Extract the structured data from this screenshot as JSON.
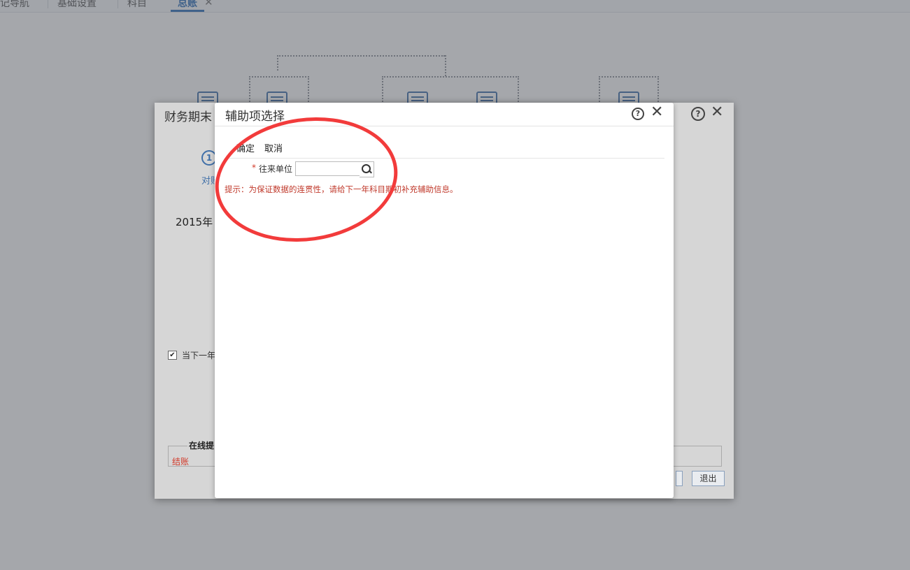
{
  "top_tabs": [
    "记导航",
    "基础设置",
    "科目",
    "总账"
  ],
  "active_tab": "总账",
  "outer_dialog": {
    "title": "财务期末",
    "step_number": "1",
    "step_label": "对账",
    "year_text": "2015年",
    "checkbox_label": "当下一年",
    "online_legend": "在线提",
    "online_item": "结账",
    "exit_button": "退出"
  },
  "inner_dialog": {
    "title": "辅助项选择",
    "toolbar": {
      "confirm_label": "确定",
      "cancel_label": "取消"
    },
    "field": {
      "required_mark": "*",
      "label": "往来单位",
      "value": "",
      "placeholder": ""
    },
    "hint": "提示：为保证数据的连贯性，请给下一年科目期初补充辅助信息。"
  },
  "colors": {
    "accent": "#2f6fb8",
    "annotation": "#f23b3b",
    "hint": "#c0392b"
  },
  "icons": [
    "question-icon",
    "close-icon",
    "search-icon",
    "checkbox-checked-icon"
  ]
}
